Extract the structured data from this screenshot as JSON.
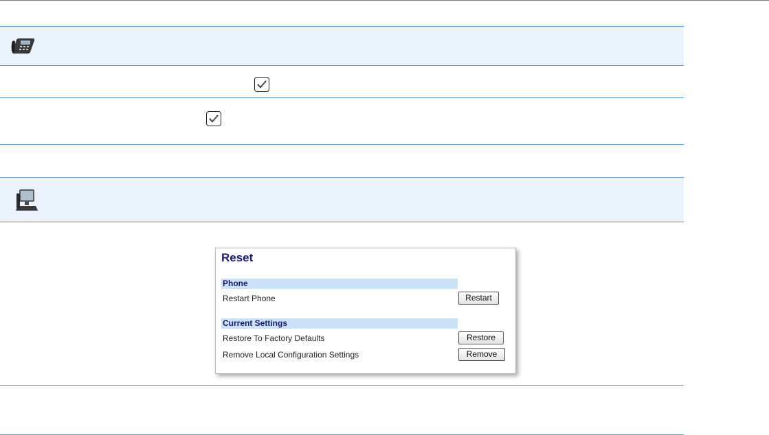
{
  "reset_panel": {
    "title": "Reset",
    "sections": [
      {
        "heading": "Phone",
        "rows": [
          {
            "label": "Restart Phone",
            "button": "Restart"
          }
        ]
      },
      {
        "heading": "Current Settings",
        "rows": [
          {
            "label": "Restore To Factory Defaults",
            "button": "Restore"
          },
          {
            "label": "Remove Local Configuration Settings",
            "button": "Remove"
          }
        ]
      }
    ]
  },
  "icons": [
    "ip-phone-icon",
    "checkbox-checked-icon",
    "checkbox-checked-icon",
    "computer-icon"
  ],
  "colors": {
    "rule": "#5b9bd5",
    "band": "#eaf2fb",
    "section": "#c9e2f9",
    "title": "#1a1a7a"
  }
}
